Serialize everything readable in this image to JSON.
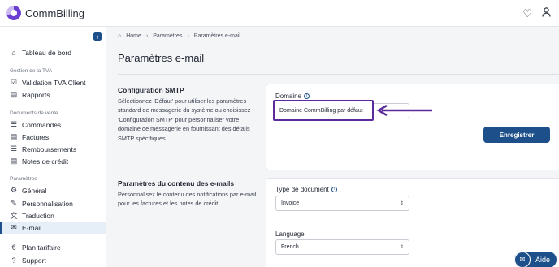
{
  "app": {
    "name": "CommBilling"
  },
  "topbar": {
    "heart_icon": "heart-icon",
    "account_icon": "account-icon"
  },
  "sidebar": {
    "collapse_icon": "chevron-left-icon",
    "items": [
      {
        "label": "Tableau de bord",
        "icon": "dashboard-icon"
      },
      {
        "label": "Validation TVA Client",
        "icon": "checklist-icon"
      },
      {
        "label": "Rapports",
        "icon": "document-icon"
      },
      {
        "label": "Commandes",
        "icon": "list-icon"
      },
      {
        "label": "Factures",
        "icon": "document-icon"
      },
      {
        "label": "Remboursements",
        "icon": "list-icon"
      },
      {
        "label": "Notes de crédit",
        "icon": "document-icon"
      },
      {
        "label": "Général",
        "icon": "gear-icon"
      },
      {
        "label": "Personnalisation",
        "icon": "brush-icon"
      },
      {
        "label": "Traduction",
        "icon": "translate-icon"
      },
      {
        "label": "E-mail",
        "icon": "email-icon"
      },
      {
        "label": "Plan tarifaire",
        "icon": "euro-icon"
      },
      {
        "label": "Support",
        "icon": "help-icon"
      }
    ],
    "sections": {
      "tva": "Gestion de la TVA",
      "documents": "Documents de vente",
      "parametres": "Paramètres"
    }
  },
  "breadcrumb": {
    "home": "Home",
    "parametres": "Paramètres",
    "current": "Paramètres e-mail"
  },
  "page": {
    "title": "Paramètres e-mail"
  },
  "smtp": {
    "title": "Configuration SMTP",
    "description": "Sélectionnez 'Défaut' pour utiliser les paramètres standard de messagerie du système ou choisissez 'Configuration SMTP' pour personnaliser votre domaine de messagerie en fournissant des détails SMTP spécifiques.",
    "domain_label": "Domaine",
    "domain_value": "Domaine CommBilling par défaut",
    "save_label": "Enregistrer"
  },
  "content": {
    "title": "Paramètres du contenu des e-mails",
    "description": "Personnalisez le contenu des notifications par e-mail pour les factures et les notes de crédit.",
    "doc_type_label": "Type de document",
    "doc_type_value": "Invoice",
    "language_label": "Language",
    "language_value": "French"
  },
  "help": {
    "label": "Aide"
  },
  "colors": {
    "brand": "#1d4f8a",
    "highlight": "#5b2a9c"
  }
}
